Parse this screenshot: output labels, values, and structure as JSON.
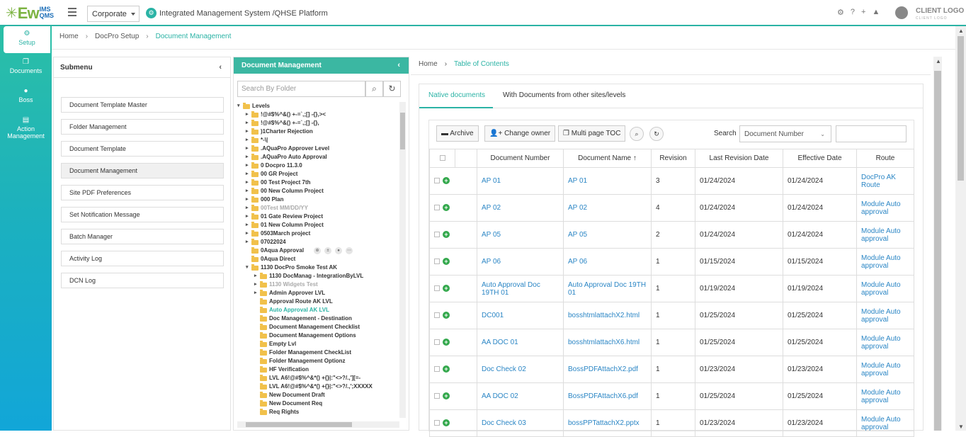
{
  "header": {
    "logo_ew": "Ew",
    "logo_ims": "IMS",
    "logo_qms": "QMS",
    "org_select": "Corporate",
    "app_title": "Integrated Management System /QHSE Platform",
    "client_logo": "CLIENT LOGO",
    "client_logo_sub": "CLIENT LOGO"
  },
  "leftnav": [
    {
      "label": "Setup",
      "icon": "gears-icon",
      "active": true
    },
    {
      "label": "Documents",
      "icon": "documents-icon"
    },
    {
      "label": "Boss",
      "icon": "person-icon"
    },
    {
      "label": "Action Management",
      "icon": "clipboard-icon"
    }
  ],
  "breadcrumb": [
    "Home",
    "DocPro Setup",
    "Document Management"
  ],
  "submenu": {
    "title": "Submenu",
    "items": [
      "Document Template Master",
      "Folder Management",
      "Document Template",
      "Document Management",
      "Site PDF Preferences",
      "Set Notification Message",
      "Batch Manager",
      "Activity Log",
      "DCN Log"
    ],
    "active_index": 3
  },
  "docmgmt": {
    "title": "Document Management",
    "search_placeholder": "Search By Folder",
    "tree": [
      {
        "label": "Levels",
        "depth": 0,
        "toggle": "minus"
      },
      {
        "label": "!@#$%^&() +-=`,;[] -{},><",
        "depth": 1
      },
      {
        "label": "!@#$%^&() +-=`,;[] -{},",
        "depth": 1
      },
      {
        "label": ")1Charter Rejection",
        "depth": 1
      },
      {
        "label": "*-\\|",
        "depth": 1
      },
      {
        "label": ".AQuaPro Approver Level",
        "depth": 1
      },
      {
        "label": ".AQuaPro Auto Approval",
        "depth": 1
      },
      {
        "label": "0 Docpro 11.3.0",
        "depth": 1
      },
      {
        "label": "00 GR Project",
        "depth": 1
      },
      {
        "label": "00 Test Project 7th",
        "depth": 1
      },
      {
        "label": "00  New Column Project",
        "depth": 1
      },
      {
        "label": "000 Plan",
        "depth": 1
      },
      {
        "label": "00Test MM/DD/YY",
        "depth": 1,
        "style": "grey"
      },
      {
        "label": "01 Gate Review Project",
        "depth": 1
      },
      {
        "label": "01  New Column Project",
        "depth": 1
      },
      {
        "label": "0503March project",
        "depth": 1
      },
      {
        "label": "07022024",
        "depth": 1
      },
      {
        "label": "0Aqua Approval",
        "depth": 1,
        "toggle": "none",
        "actions": true
      },
      {
        "label": "0Aqua Direct",
        "depth": 1,
        "toggle": "none"
      },
      {
        "label": "1130 DocPro Smoke Test AK",
        "depth": 1,
        "toggle": "minus"
      },
      {
        "label": "1130 DocManag - IntegrationByLVL",
        "depth": 2
      },
      {
        "label": "1130 Widgets Test",
        "depth": 2,
        "style": "grey"
      },
      {
        "label": "Admin Approver LVL",
        "depth": 2
      },
      {
        "label": "Approval Route AK LVL",
        "depth": 2,
        "toggle": "none"
      },
      {
        "label": "Auto Approval AK LVL",
        "depth": 2,
        "toggle": "none",
        "style": "teal"
      },
      {
        "label": "Doc Management - Destination",
        "depth": 2,
        "toggle": "none"
      },
      {
        "label": "Document Management Checklist",
        "depth": 2,
        "toggle": "none"
      },
      {
        "label": "Document Management Options",
        "depth": 2,
        "toggle": "none"
      },
      {
        "label": "Empty Lvl",
        "depth": 2,
        "toggle": "none"
      },
      {
        "label": "Folder Management CheckList",
        "depth": 2,
        "toggle": "none"
      },
      {
        "label": "Folder Management Optionz",
        "depth": 2,
        "toggle": "none"
      },
      {
        "label": "HF Verification",
        "depth": 2,
        "toggle": "none"
      },
      {
        "label": "LVL A6!@#$%^&*() +{}|:\"<>?/.,'][=-",
        "depth": 2,
        "toggle": "none"
      },
      {
        "label": "LVL A6!@#$%^&*() +{}|:\"<>?/.,';XXXXX",
        "depth": 2,
        "toggle": "none"
      },
      {
        "label": "New Document Draft",
        "depth": 2,
        "toggle": "none"
      },
      {
        "label": "New Document Req",
        "depth": 2,
        "toggle": "none"
      },
      {
        "label": "Req Rights",
        "depth": 2,
        "toggle": "none"
      }
    ]
  },
  "content": {
    "breadcrumb": [
      "Home",
      "Table of Contents"
    ],
    "tabs": [
      "Native documents",
      "With Documents from other sites/levels"
    ],
    "toolbar": {
      "archive": "Archive",
      "change_owner": "Change owner",
      "multi_toc": "Multi page TOC",
      "search_label": "Search",
      "search_field": "Document Number",
      "search_value": ""
    },
    "columns": [
      "Document Number",
      "Document Name",
      "Revision",
      "Last Revision Date",
      "Effective Date",
      "Route"
    ],
    "sort_indicator": "↑",
    "rows": [
      {
        "number": "AP 01",
        "name": "AP 01",
        "rev": "3",
        "last": "01/24/2024",
        "eff": "01/24/2024",
        "route": "DocPro AK Route"
      },
      {
        "number": "AP 02",
        "name": "AP 02",
        "rev": "4",
        "last": "01/24/2024",
        "eff": "01/24/2024",
        "route": "Module Auto approval"
      },
      {
        "number": "AP 05",
        "name": "AP 05",
        "rev": "2",
        "last": "01/24/2024",
        "eff": "01/24/2024",
        "route": "Module Auto approval"
      },
      {
        "number": "AP 06",
        "name": "AP 06",
        "rev": "1",
        "last": "01/15/2024",
        "eff": "01/15/2024",
        "route": "Module Auto approval"
      },
      {
        "number": "Auto Approval Doc 19TH 01",
        "name": "Auto Approval Doc 19TH 01",
        "rev": "1",
        "last": "01/19/2024",
        "eff": "01/19/2024",
        "route": "Module Auto approval"
      },
      {
        "number": "DC001",
        "name": "bosshtmlattachX2.html",
        "rev": "1",
        "last": "01/25/2024",
        "eff": "01/25/2024",
        "route": "Module Auto approval"
      },
      {
        "number": "AA DOC 01",
        "name": "bosshtmlattachX6.html",
        "rev": "1",
        "last": "01/25/2024",
        "eff": "01/25/2024",
        "route": "Module Auto approval"
      },
      {
        "number": "Doc Check 02",
        "name": "BossPDFAttachX2.pdf",
        "rev": "1",
        "last": "01/23/2024",
        "eff": "01/23/2024",
        "route": "Module Auto approval"
      },
      {
        "number": "AA DOC 02",
        "name": "BossPDFAttachX6.pdf",
        "rev": "1",
        "last": "01/25/2024",
        "eff": "01/25/2024",
        "route": "Module Auto approval"
      },
      {
        "number": "Doc Check 03",
        "name": "bossPPTattachX2.pptx",
        "rev": "1",
        "last": "01/23/2024",
        "eff": "01/23/2024",
        "route": "Module Auto approval"
      }
    ]
  },
  "colors": {
    "accent": "#2bb3a5",
    "link": "#2b86c5",
    "plus": "#33a84c"
  }
}
